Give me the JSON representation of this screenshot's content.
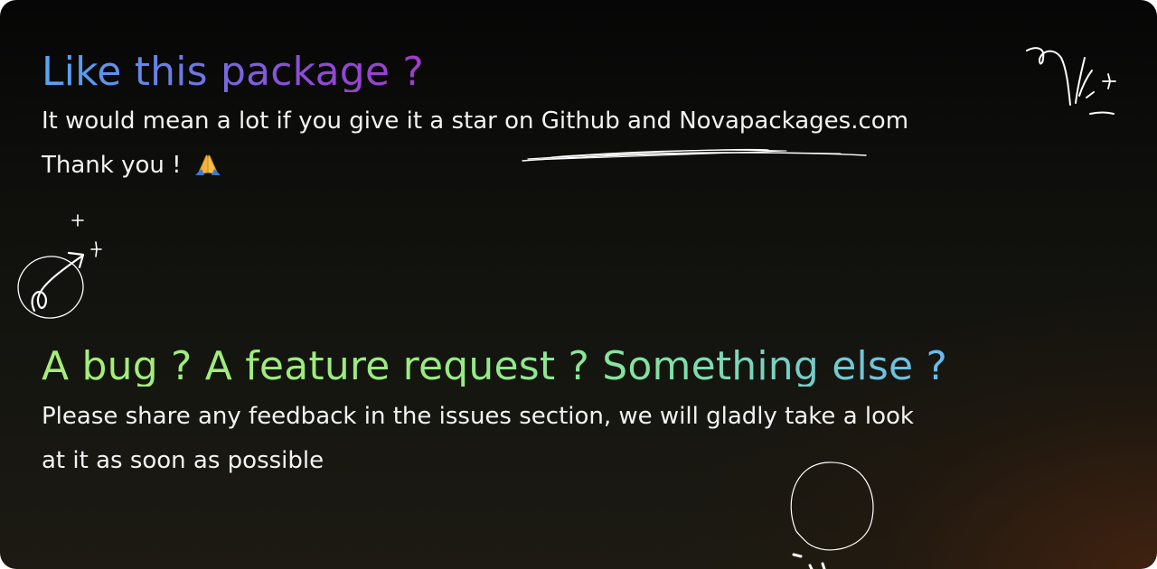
{
  "star_section": {
    "heading": "Like this package ?",
    "line1": "It would mean a lot if you give it a star on Github and Novapackages.com",
    "line2": "Thank you !",
    "emoji_icon": "folded-hands-icon"
  },
  "feedback_section": {
    "heading": "A bug ? A feature request ? Something else ?",
    "line1": "Please share any feedback in the issues section, we will gladly take a look",
    "line2": "at it as soon as possible"
  },
  "colors": {
    "heading1_gradient": [
      "#53a8f1",
      "#8a4fd8",
      "#a23bd0"
    ],
    "heading2_gradient": [
      "#a6ed78",
      "#7fe0a8",
      "#6bb9ec"
    ],
    "background": "#0f0f0c",
    "background_glow": "#46230f",
    "text": "#f3f3f3"
  }
}
